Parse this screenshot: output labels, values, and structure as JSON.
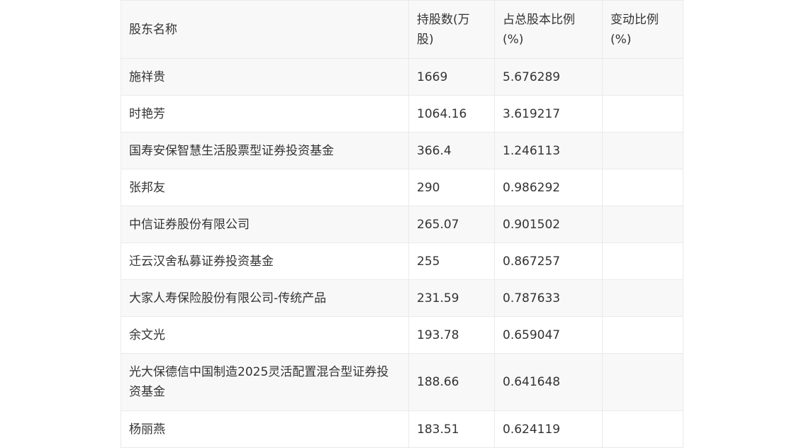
{
  "table": {
    "headers": [
      "股东名称",
      "持股数(万股)",
      "占总股本比例(%)",
      "变动比例(%)"
    ],
    "rows": [
      {
        "name": "施祥贵",
        "shares": "1669",
        "ratio": "5.676289",
        "change": ""
      },
      {
        "name": "时艳芳",
        "shares": "1064.16",
        "ratio": "3.619217",
        "change": ""
      },
      {
        "name": "国寿安保智慧生活股票型证券投资基金",
        "shares": "366.4",
        "ratio": "1.246113",
        "change": ""
      },
      {
        "name": "张邦友",
        "shares": "290",
        "ratio": "0.986292",
        "change": ""
      },
      {
        "name": "中信证券股份有限公司",
        "shares": "265.07",
        "ratio": "0.901502",
        "change": ""
      },
      {
        "name": "迁云汉舍私募证券投资基金",
        "shares": "255",
        "ratio": "0.867257",
        "change": ""
      },
      {
        "name": "大家人寿保险股份有限公司-传统产品",
        "shares": "231.59",
        "ratio": "0.787633",
        "change": ""
      },
      {
        "name": "余文光",
        "shares": "193.78",
        "ratio": "0.659047",
        "change": ""
      },
      {
        "name": "光大保德信中国制造2025灵活配置混合型证券投资基金",
        "shares": "188.66",
        "ratio": "0.641648",
        "change": ""
      },
      {
        "name": "杨丽燕",
        "shares": "183.51",
        "ratio": "0.624119",
        "change": ""
      }
    ]
  }
}
